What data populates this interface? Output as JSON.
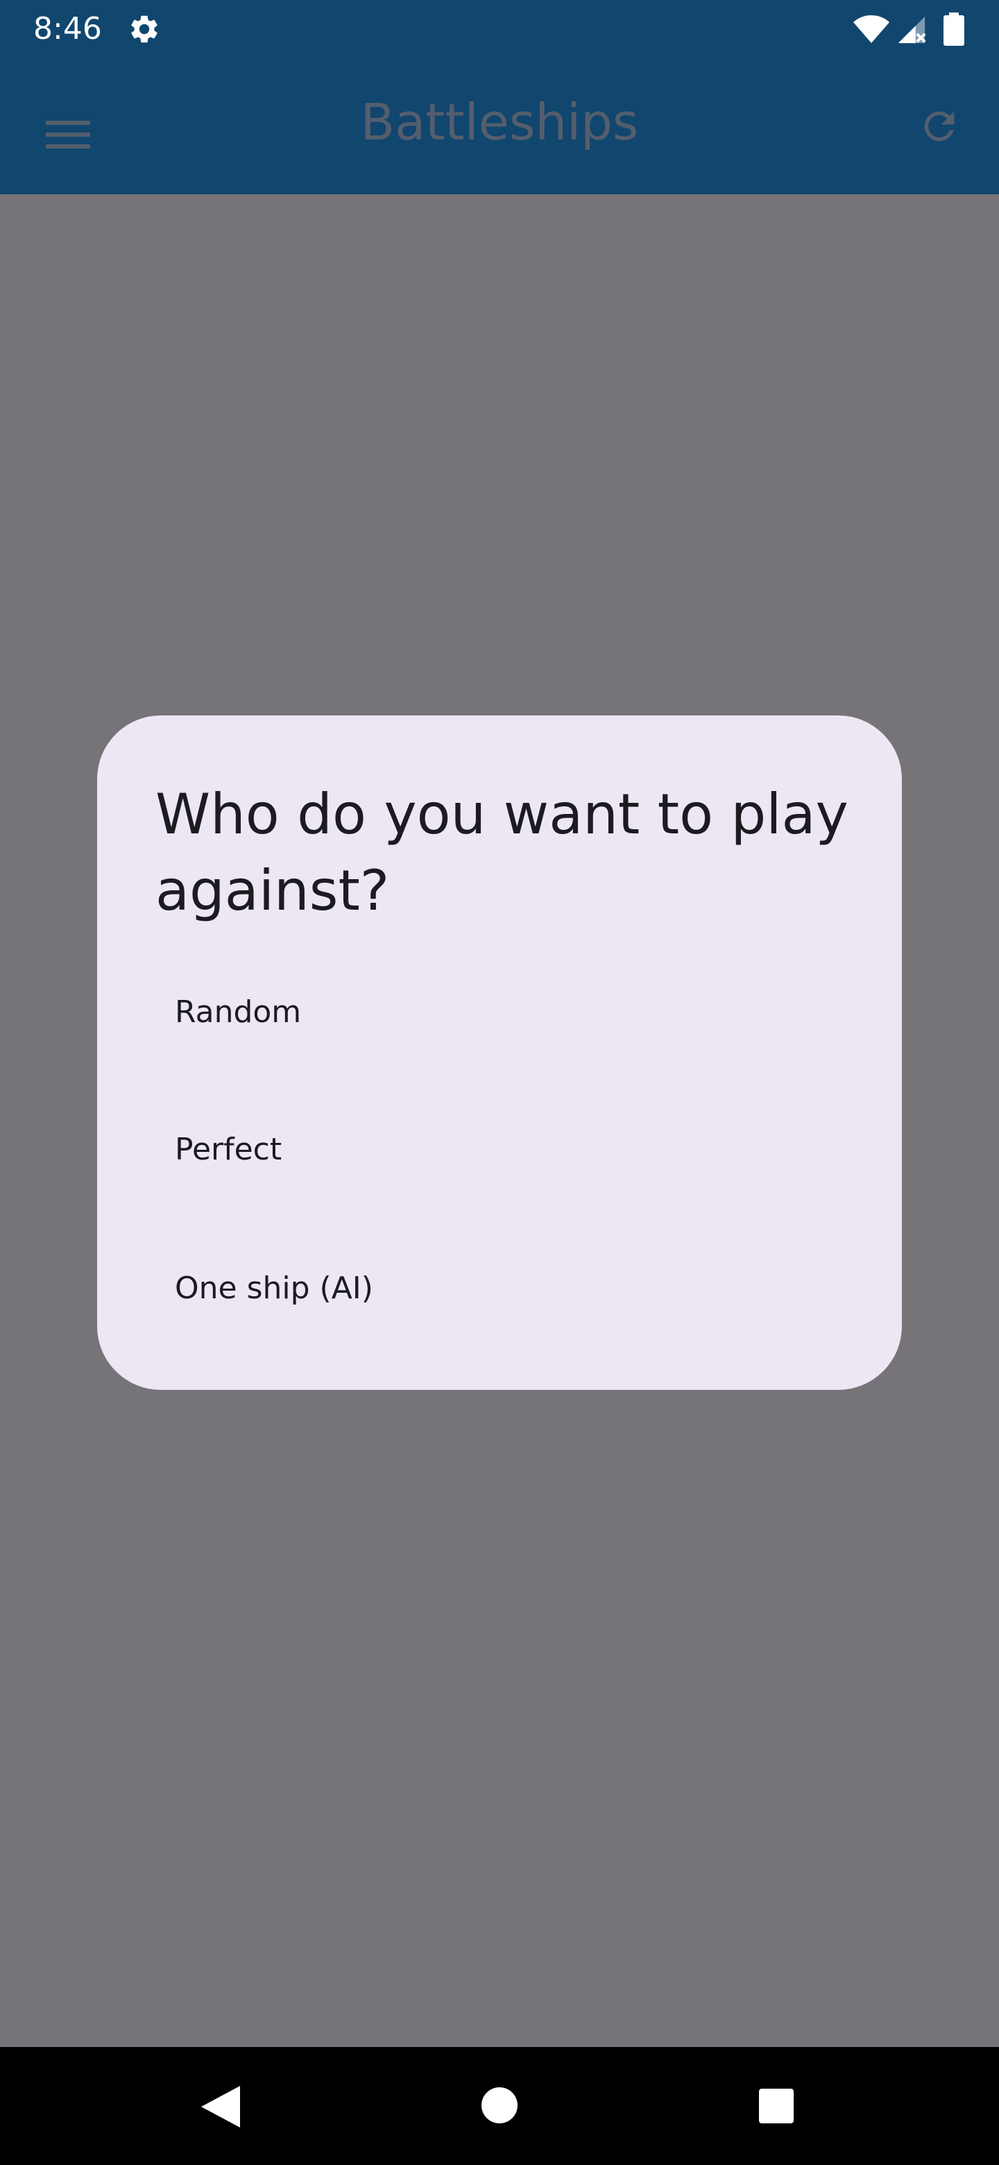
{
  "status_bar": {
    "time": "8:46",
    "icons": [
      "gear-icon",
      "wifi-icon",
      "cell-signal-icon",
      "battery-icon"
    ]
  },
  "app_bar": {
    "title": "Battleships",
    "left_icon": "menu-icon",
    "right_icon": "refresh-icon"
  },
  "dialog": {
    "title": "Who do you want to play against?",
    "options": [
      {
        "label": "Random"
      },
      {
        "label": "Perfect"
      },
      {
        "label": "One ship (AI)"
      }
    ]
  },
  "nav_bar": {
    "icons": [
      "back-icon",
      "home-icon",
      "recents-icon"
    ]
  },
  "colors": {
    "app_bar": "#11466f",
    "scrim_background": "#767479",
    "dialog_surface": "#ede7f4",
    "text": "#1c1b20",
    "dimmed_app_content": "#545e6d"
  }
}
